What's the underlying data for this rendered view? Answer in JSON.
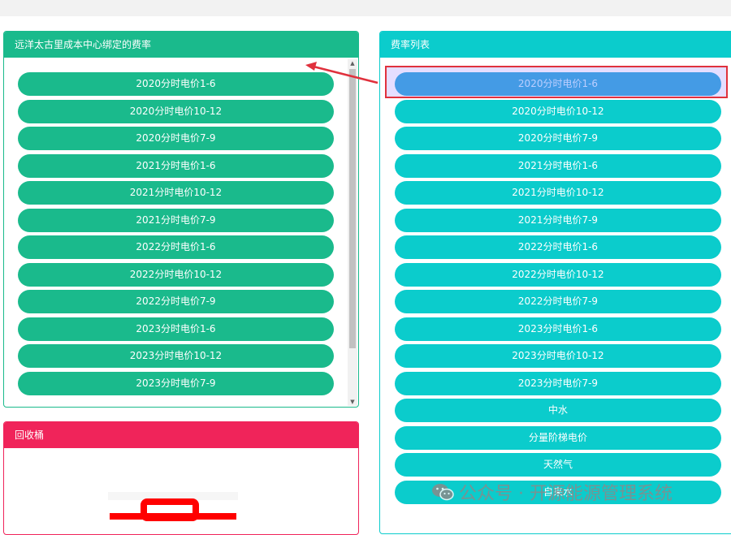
{
  "bound_panel": {
    "title": "远洋太古里成本中心绑定的费率",
    "items": [
      "2020分时电价1-6",
      "2020分时电价10-12",
      "2020分时电价7-9",
      "2021分时电价1-6",
      "2021分时电价10-12",
      "2021分时电价7-9",
      "2022分时电价1-6",
      "2022分时电价10-12",
      "2022分时电价7-9",
      "2023分时电价1-6",
      "2023分时电价10-12",
      "2023分时电价7-9"
    ],
    "scroll_up_glyph": "▲",
    "scroll_down_glyph": "▼"
  },
  "rate_panel": {
    "title": "费率列表",
    "items": [
      "2020分时电价1-6",
      "2020分时电价10-12",
      "2020分时电价7-9",
      "2021分时电价1-6",
      "2021分时电价10-12",
      "2021分时电价7-9",
      "2022分时电价1-6",
      "2022分时电价10-12",
      "2022分时电价7-9",
      "2023分时电价1-6",
      "2023分时电价10-12",
      "2023分时电价7-9",
      "中水",
      "分量阶梯电价",
      "天然气",
      "自来水"
    ],
    "selected_index": 0
  },
  "recycle_panel": {
    "title": "回收桶",
    "icon": "trash-icon"
  },
  "watermark": {
    "text": "公众号 · 开源能源管理系统",
    "icon": "wechat-icon"
  },
  "colors": {
    "green": "#1aba8c",
    "teal": "#0bcccc",
    "red": "#f0245a",
    "selected": "#0899d8",
    "annotation": "#e0313d"
  }
}
